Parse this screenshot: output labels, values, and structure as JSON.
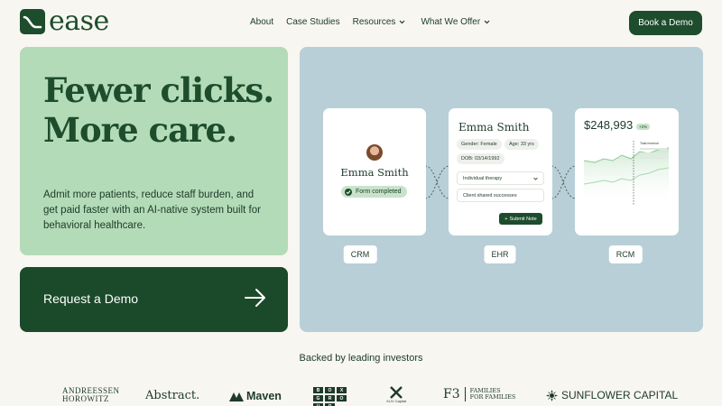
{
  "brand": {
    "name": "ease"
  },
  "nav": {
    "links": [
      {
        "label": "About",
        "has_dropdown": false
      },
      {
        "label": "Case Studies",
        "has_dropdown": false
      },
      {
        "label": "Resources",
        "has_dropdown": true
      },
      {
        "label": "What We Offer",
        "has_dropdown": true
      }
    ],
    "cta": "Book a Demo"
  },
  "hero": {
    "title_line1": "Fewer clicks.",
    "title_line2": "More care.",
    "subtitle": "Admit more patients, reduce staff burden, and get paid faster with an AI-native system built for behavioral healthcare.",
    "demo_cta": "Request a Demo",
    "demo_icon": "arrow-right-icon"
  },
  "panel": {
    "crm": {
      "label": "CRM",
      "patient_name": "Emma Smith",
      "status": "Form completed"
    },
    "ehr": {
      "label": "EHR",
      "patient_name": "Emma Smith",
      "gender": "Gender: Female",
      "age": "Age: 33 yrs",
      "dob": "DOB: 03/14/1992",
      "therapy_select": "Individual therapy",
      "note_text": "Client shared successes",
      "submit": "Submit Note"
    },
    "rcm": {
      "label": "RCM",
      "amount": "$248,993",
      "change": "+2%",
      "legend_title": "Total revenue"
    }
  },
  "investors": {
    "heading": "Backed by leading investors",
    "logos": {
      "a16z_line1": "ANDREESSEN",
      "a16z_line2": "HOROWITZ",
      "abstract": "Abstract.",
      "maven": "Maven",
      "boxgroup": [
        "B",
        "O",
        "X",
        "G",
        "R",
        "O",
        "U",
        "P"
      ],
      "xliv": "XLIV Capital",
      "f3_big": "F3",
      "f3_line1": "FAMILIES",
      "f3_line2": "FOR FAMILIES",
      "sunflower": "SUNFLOWER CAPITAL"
    }
  },
  "colors": {
    "brand_green": "#1d4d2c",
    "hero_green": "#b4dbb7",
    "panel_blue": "#b8cfd8",
    "background": "#f7f6f1"
  }
}
